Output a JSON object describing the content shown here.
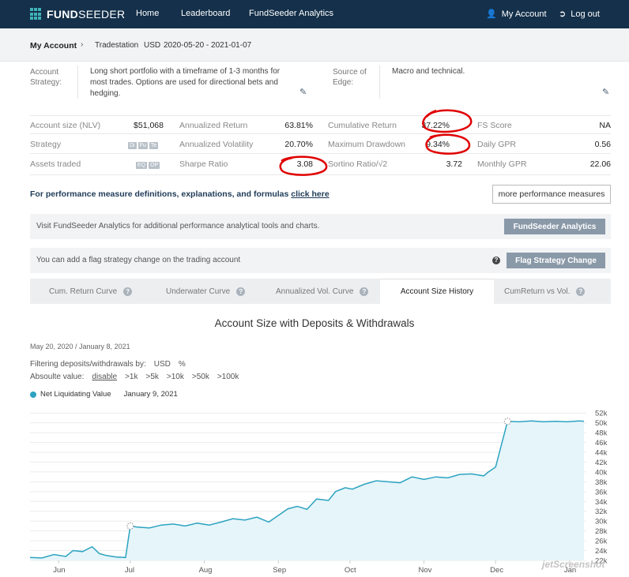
{
  "nav": {
    "brand_bold": "FUND",
    "brand_light": "SEEDER",
    "home": "Home",
    "leaderboard": "Leaderboard",
    "analytics": "FundSeeder Analytics",
    "my_account": "My Account",
    "logout": "Log out"
  },
  "breadcrumb": {
    "title": "My Account",
    "broker": "Tradestation",
    "currency": "USD",
    "range": "2020-05-20 - 2021-01-07"
  },
  "strategy": {
    "label_line1": "Account",
    "label_line2": "Strategy:",
    "text": "Long short portfolio with a timeframe of 1-3 months for most trades. Options are used for directional bets and hedging.",
    "edge_label_line1": "Source of",
    "edge_label_line2": "Edge:",
    "edge_text": "Macro and technical."
  },
  "stats": {
    "account_size_label": "Account size (NLV)",
    "account_size": "$51,068",
    "ann_return_label": "Annualized Return",
    "ann_return": "63.81%",
    "cum_return_label": "Cumulative Return",
    "cum_return": "37.22%",
    "fs_score_label": "FS Score",
    "fs_score": "NA",
    "strategy_label": "Strategy",
    "strategy_chips": [
      "Di",
      "Fu",
      "Te"
    ],
    "ann_vol_label": "Annualized Volatility",
    "ann_vol": "20.70%",
    "max_dd_label": "Maximum Drawdown",
    "max_dd": "9.34%",
    "daily_gpr_label": "Daily GPR",
    "daily_gpr": "0.56",
    "assets_label": "Assets traded",
    "assets_chips": [
      "EQ",
      "OP"
    ],
    "sharpe_label": "Sharpe Ratio",
    "sharpe": "3.08",
    "sortino_label": "Sortino Ratio/√2",
    "sortino": "3.72",
    "monthly_gpr_label": "Monthly GPR",
    "monthly_gpr": "22.06"
  },
  "perf": {
    "note": "For performance measure definitions, explanations, and formulas ",
    "link": "click here",
    "more_button": "more performance measures"
  },
  "analytics_bar": {
    "message": "Visit FundSeeder Analytics for additional performance analytical tools and charts.",
    "button": "FundSeeder Analytics"
  },
  "flag_bar": {
    "message": "You can add a flag strategy change on the trading account",
    "button": "Flag Strategy Change"
  },
  "tabs": [
    {
      "label": "Cum. Return Curve"
    },
    {
      "label": "Underwater Curve"
    },
    {
      "label": "Annualized Vol. Curve"
    },
    {
      "label": "Account Size History"
    },
    {
      "label": "CumReturn vs Vol."
    }
  ],
  "chart_header": {
    "title": "Account Size with Deposits & Withdrawals",
    "date_range": "May 20, 2020 / January 8, 2021",
    "filter_label": "Filtering deposits/withdrawals by:",
    "filter_usd": "USD",
    "filter_pct": "%",
    "abs_label": "Absoulte value:",
    "abs_options": [
      "disable",
      ">1k",
      ">5k",
      ">10k",
      ">50k",
      ">100k"
    ],
    "legend_series": "Net Liquidating Value",
    "legend_date": "January 9, 2021"
  },
  "watermark": "jetScreenshot",
  "colors": {
    "nav_bg": "#14304a",
    "line": "#2ca3c0",
    "fill": "#e6f5fa",
    "highlight": "#e00000",
    "button_gray": "#8a99a8"
  },
  "chart_data": {
    "type": "area",
    "title": "Account Size with Deposits & Withdrawals",
    "series_name": "Net Liquidating Value",
    "yticks": [
      "22k",
      "24k",
      "26k",
      "28k",
      "30k",
      "32k",
      "34k",
      "36k",
      "38k",
      "40k",
      "42k",
      "44k",
      "46k",
      "48k",
      "50k",
      "52k"
    ],
    "ylim": [
      22000,
      53000
    ],
    "xticks": [
      "Jun",
      "Jul",
      "Aug",
      "Sep",
      "Oct",
      "Nov",
      "Dec",
      "Jan"
    ],
    "x_days": [
      0,
      5,
      10,
      15,
      18,
      22,
      26,
      29,
      32,
      36,
      40,
      42,
      45,
      50,
      55,
      60,
      65,
      70,
      75,
      80,
      85,
      90,
      95,
      100,
      105,
      108,
      112,
      116,
      120,
      125,
      128,
      132,
      135,
      140,
      145,
      150,
      155,
      160,
      165,
      170,
      175,
      180,
      185,
      190,
      192,
      195,
      200,
      205,
      210,
      215,
      220,
      225,
      230,
      232
    ],
    "values": [
      22600,
      22500,
      23200,
      22800,
      24000,
      23800,
      24800,
      23400,
      23000,
      22700,
      22600,
      29000,
      28800,
      28600,
      29200,
      29400,
      29000,
      29600,
      29200,
      29800,
      30500,
      30200,
      30800,
      29800,
      31500,
      32500,
      33000,
      32400,
      34500,
      34200,
      36000,
      36800,
      36500,
      37500,
      38200,
      38000,
      37800,
      39000,
      38500,
      39000,
      38800,
      39500,
      39600,
      39200,
      40000,
      41000,
      50300,
      50200,
      50400,
      50200,
      50300,
      50200,
      50400,
      50300
    ],
    "x_start": "2020-05-20",
    "month_start_days": [
      12,
      42,
      73,
      104,
      134,
      165,
      195,
      226
    ]
  }
}
